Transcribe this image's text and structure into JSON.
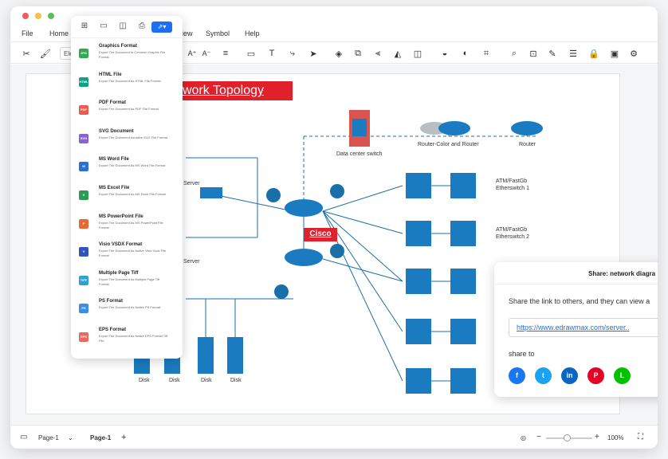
{
  "window": {
    "dot_colors": [
      "#f25c54",
      "#f7c04a",
      "#5ac05a"
    ]
  },
  "menu": {
    "file": "File",
    "home": "Home",
    "view": "iew",
    "symbol": "Symbol",
    "help": "Help"
  },
  "toolbar": {
    "font_value": "Ele",
    "font_grow": "A⁺",
    "font_shrink": "A⁻"
  },
  "diagram": {
    "title": "work Topology",
    "labels": {
      "data_center_switch": "Data center switch",
      "router_color": "Router-Color and Router",
      "router": "Router",
      "server_top": "Server",
      "server_bottom": "Server",
      "cisco": "Cisco",
      "atm1_line1": "ATM/FastGb",
      "atm1_line2": "Etherswitch 1",
      "atm2_line1": "ATM/FastGb",
      "atm2_line2": "Etherswitch 2",
      "disk": "Disk"
    },
    "colors": {
      "device": "#1b7bc0",
      "title_bg": "#e0202a"
    }
  },
  "export_menu": {
    "items": [
      {
        "title": "Graphics Format",
        "desc": "Export The Document to Common Graphic File Format",
        "icon": "JPG",
        "color": "#34a853"
      },
      {
        "title": "HTML File",
        "desc": "Export The Document As HTML File Format",
        "icon": "HTML",
        "color": "#14a085"
      },
      {
        "title": "PDF Format",
        "desc": "Export The Document As PDF File Format",
        "icon": "PDF",
        "color": "#ea5b50"
      },
      {
        "title": "SVG Document",
        "desc": "Export The Document Asnative SVG File Format",
        "icon": "SVG",
        "color": "#8a63d2"
      },
      {
        "title": "MS Word File",
        "desc": "Export The Document As MS Word File Format",
        "icon": "W",
        "color": "#2b6fd6"
      },
      {
        "title": "MS Excel File",
        "desc": "Export The Document As MS Excel File Format",
        "icon": "X",
        "color": "#2e9b54"
      },
      {
        "title": "MS PowerPoint File",
        "desc": "Export The Document As MS PowerPoint File Format",
        "icon": "P",
        "color": "#e8692f"
      },
      {
        "title": "Visio VSDX Format",
        "desc": "Export The Document As Native Visio Vsdx File Format",
        "icon": "V",
        "color": "#2f55b8"
      },
      {
        "title": "Multiple Page Tiff",
        "desc": "Export The Document As Multiple Page Tiff Format",
        "icon": "TIFF",
        "color": "#29a3d6"
      },
      {
        "title": "PS Format",
        "desc": "Export The Document As Native PS Format",
        "icon": "PS",
        "color": "#3a8ee6"
      },
      {
        "title": "EPS Format",
        "desc": "Export The Document As Native EPS Format Tiff File",
        "icon": "EPS",
        "color": "#e86a5e"
      }
    ]
  },
  "share": {
    "title": "Share: network diagra",
    "text": "Share the link to others, and they can view a",
    "link": "https://www.edrawmax.com/server..",
    "share_to": "share to",
    "socials": [
      {
        "name": "facebook",
        "glyph": "f",
        "color": "#1877f2"
      },
      {
        "name": "twitter",
        "glyph": "t",
        "color": "#1da1f2"
      },
      {
        "name": "linkedin",
        "glyph": "in",
        "color": "#0a66c2"
      },
      {
        "name": "pinterest",
        "glyph": "P",
        "color": "#e60023"
      },
      {
        "name": "line",
        "glyph": "L",
        "color": "#00c300"
      }
    ]
  },
  "status": {
    "page_selector": "Page-1",
    "page_tab": "Page-1",
    "add": "+",
    "zoom": "100%",
    "minus": "−",
    "plus": "+"
  }
}
